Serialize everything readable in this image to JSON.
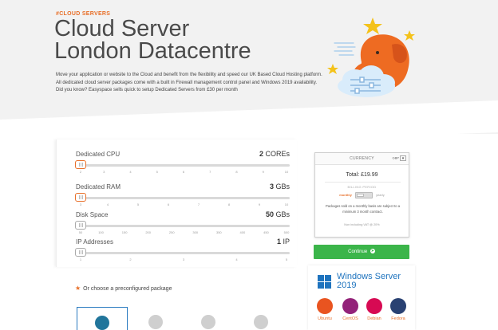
{
  "hero": {
    "eyebrow": "#CLOUD SERVERS",
    "title_line1": "Cloud Server",
    "title_line2": "London Datacentre",
    "intro_p1": "Move your application or website to the Cloud and benefit from the flexibility and speed our UK Based Cloud Hosting platform. All dedicated cloud server packages come with a built in Firewall management control panel and Windows 2019 availability.",
    "intro_p2": "Did you know? Easyspace sells quick to setup Dedicated Servers from £30 per month"
  },
  "config": {
    "rows": [
      {
        "label": "Dedicated CPU",
        "value_num": "2",
        "value_unit": "COREs",
        "ticks": [
          "2",
          "3",
          "4",
          "5",
          "6",
          "7",
          "8",
          "9",
          "10"
        ],
        "level": 0
      },
      {
        "label": "Dedicated RAM",
        "value_num": "3",
        "value_unit": "GBs",
        "ticks": [
          "3",
          "4",
          "5",
          "6",
          "7",
          "8",
          "9",
          "10"
        ],
        "level": 0
      },
      {
        "label": "Disk Space",
        "value_num": "50",
        "value_unit": "GBs",
        "ticks": [
          "50",
          "100",
          "150",
          "200",
          "250",
          "300",
          "350",
          "400",
          "450",
          "500"
        ],
        "level": 0
      },
      {
        "label": "IP Addresses",
        "value_num": "1",
        "value_unit": "IP",
        "ticks": [
          "1",
          "2",
          "3",
          "4",
          "5"
        ],
        "level": 0
      }
    ]
  },
  "pricing": {
    "currency_label": "CURRENCY",
    "currency_value": "GBP",
    "total": "Total: £19.99",
    "billing_label": "BILLING PERIOD",
    "monthly": "monthly",
    "yearly": "yearly",
    "note": "Packages sold on a monthly basis are subject to a minimum 3 month contract.",
    "vat": "Non including VAT @ 20%",
    "continue_label": "Continue"
  },
  "os": {
    "windows_text_line1": "Windows Server",
    "windows_text_line2": "2019",
    "items": [
      {
        "name": "Ubuntu",
        "color": "#e95420"
      },
      {
        "name": "CentOS",
        "color": "#932279"
      },
      {
        "name": "Debian",
        "color": "#d70a53"
      },
      {
        "name": "Fedora",
        "color": "#294172"
      }
    ]
  },
  "preconfigured": {
    "label": "Or choose a preconfigured package",
    "packages": [
      {
        "icon": "wordpress-icon",
        "active": true
      },
      {
        "icon": "joomla-icon",
        "active": false
      },
      {
        "icon": "drupal-icon",
        "active": false
      },
      {
        "icon": "magento-icon",
        "active": false
      }
    ]
  },
  "colors": {
    "accent": "#e8702a",
    "continue": "#3bb54a",
    "windows": "#1e73be"
  }
}
